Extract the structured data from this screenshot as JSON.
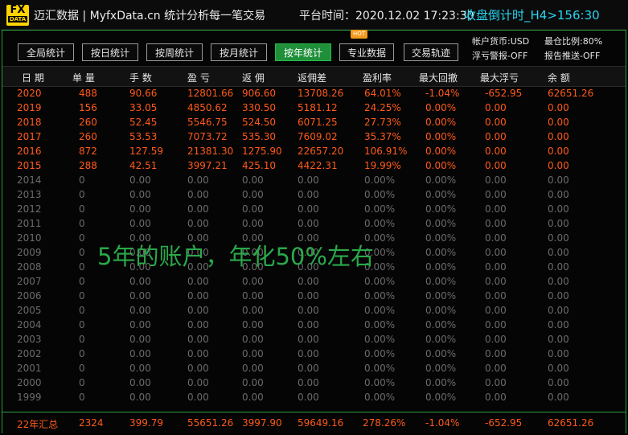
{
  "header": {
    "logo_top": "FX",
    "logo_bottom": "DATA",
    "brand": "迈汇数据 | MyfxData.cn  统计分析每一笔交易",
    "platform_time": "平台时间：2020.12.02 17:23:30",
    "countdown": "收盘倒计时_H4>156:30"
  },
  "tabs": [
    {
      "label": "全局统计"
    },
    {
      "label": "按日统计"
    },
    {
      "label": "按周统计"
    },
    {
      "label": "按月统计"
    },
    {
      "label": "按年统计"
    },
    {
      "label": "专业数据"
    },
    {
      "label": "交易轨迹"
    }
  ],
  "hot_badge": "HOT",
  "info": {
    "currency": "帐户货币:USD",
    "ratio": "最仓比例:80%",
    "alert": "浮亏警报-OFF",
    "report": "报告推送-OFF"
  },
  "columns": [
    "日 期",
    "单 量",
    "手 数",
    "盈 亏",
    "返 佣",
    "返佣差",
    "盈利率",
    "最大回撤",
    "最大浮亏",
    "余 额"
  ],
  "rows": [
    [
      "2020",
      "488",
      "90.66",
      "12801.66",
      "906.60",
      "13708.26",
      "64.01%",
      "-1.04%",
      "-652.95",
      "62651.26"
    ],
    [
      "2019",
      "156",
      "33.05",
      "4850.62",
      "330.50",
      "5181.12",
      "24.25%",
      "0.00%",
      "0.00",
      "0.00"
    ],
    [
      "2018",
      "260",
      "52.45",
      "5546.75",
      "524.50",
      "6071.25",
      "27.73%",
      "0.00%",
      "0.00",
      "0.00"
    ],
    [
      "2017",
      "260",
      "53.53",
      "7073.72",
      "535.30",
      "7609.02",
      "35.37%",
      "0.00%",
      "0.00",
      "0.00"
    ],
    [
      "2016",
      "872",
      "127.59",
      "21381.30",
      "1275.90",
      "22657.20",
      "106.91%",
      "0.00%",
      "0.00",
      "0.00"
    ],
    [
      "2015",
      "288",
      "42.51",
      "3997.21",
      "425.10",
      "4422.31",
      "19.99%",
      "0.00%",
      "0.00",
      "0.00"
    ],
    [
      "2014",
      "0",
      "0.00",
      "0.00",
      "0.00",
      "0.00",
      "0.00%",
      "0.00%",
      "0.00",
      "0.00"
    ],
    [
      "2013",
      "0",
      "0.00",
      "0.00",
      "0.00",
      "0.00",
      "0.00%",
      "0.00%",
      "0.00",
      "0.00"
    ],
    [
      "2012",
      "0",
      "0.00",
      "0.00",
      "0.00",
      "0.00",
      "0.00%",
      "0.00%",
      "0.00",
      "0.00"
    ],
    [
      "2011",
      "0",
      "0.00",
      "0.00",
      "0.00",
      "0.00",
      "0.00%",
      "0.00%",
      "0.00",
      "0.00"
    ],
    [
      "2010",
      "0",
      "0.00",
      "0.00",
      "0.00",
      "0.00",
      "0.00%",
      "0.00%",
      "0.00",
      "0.00"
    ],
    [
      "2009",
      "0",
      "0.00",
      "0.00",
      "0.00",
      "0.00",
      "0.00%",
      "0.00%",
      "0.00",
      "0.00"
    ],
    [
      "2008",
      "0",
      "0.00",
      "0.00",
      "0.00",
      "0.00",
      "0.00%",
      "0.00%",
      "0.00",
      "0.00"
    ],
    [
      "2007",
      "0",
      "0.00",
      "0.00",
      "0.00",
      "0.00",
      "0.00%",
      "0.00%",
      "0.00",
      "0.00"
    ],
    [
      "2006",
      "0",
      "0.00",
      "0.00",
      "0.00",
      "0.00",
      "0.00%",
      "0.00%",
      "0.00",
      "0.00"
    ],
    [
      "2005",
      "0",
      "0.00",
      "0.00",
      "0.00",
      "0.00",
      "0.00%",
      "0.00%",
      "0.00",
      "0.00"
    ],
    [
      "2004",
      "0",
      "0.00",
      "0.00",
      "0.00",
      "0.00",
      "0.00%",
      "0.00%",
      "0.00",
      "0.00"
    ],
    [
      "2003",
      "0",
      "0.00",
      "0.00",
      "0.00",
      "0.00",
      "0.00%",
      "0.00%",
      "0.00",
      "0.00"
    ],
    [
      "2002",
      "0",
      "0.00",
      "0.00",
      "0.00",
      "0.00",
      "0.00%",
      "0.00%",
      "0.00",
      "0.00"
    ],
    [
      "2001",
      "0",
      "0.00",
      "0.00",
      "0.00",
      "0.00",
      "0.00%",
      "0.00%",
      "0.00",
      "0.00"
    ],
    [
      "2000",
      "0",
      "0.00",
      "0.00",
      "0.00",
      "0.00",
      "0.00%",
      "0.00%",
      "0.00",
      "0.00"
    ],
    [
      "1999",
      "0",
      "0.00",
      "0.00",
      "0.00",
      "0.00",
      "0.00%",
      "0.00%",
      "0.00",
      "0.00"
    ]
  ],
  "footer": [
    "22年汇总",
    "2324",
    "399.79",
    "55651.26",
    "3997.90",
    "59649.16",
    "278.26%",
    "-1.04%",
    "-652.95",
    "62651.26"
  ],
  "overlay_text": "5年的账户，年化50%左右",
  "colors": {
    "active_row": "#ff5a1a",
    "inactive_row": "#6b6b6b",
    "accent_green": "#1f8f3a",
    "countdown": "#29d4f0",
    "overlay": "#2aa84a"
  }
}
